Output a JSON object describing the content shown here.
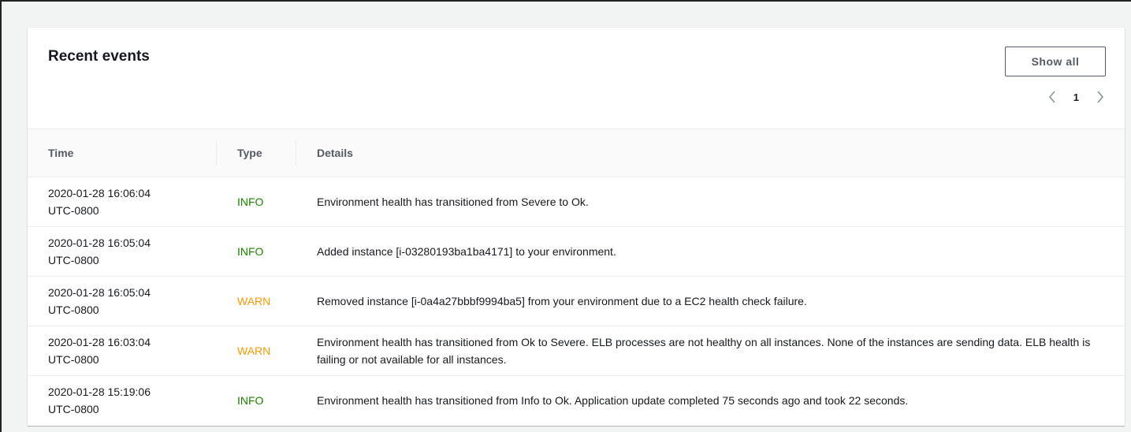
{
  "panel": {
    "title": "Recent events",
    "show_all_label": "Show all",
    "pagination": {
      "current_page": "1",
      "prev_icon": "chevron-left-icon",
      "next_icon": "chevron-right-icon"
    }
  },
  "table": {
    "columns": [
      "Time",
      "Type",
      "Details"
    ],
    "rows": [
      {
        "date": "2020-01-28 16:06:04",
        "tz": "UTC-0800",
        "type": "INFO",
        "details": "Environment health has transitioned from Severe to Ok."
      },
      {
        "date": "2020-01-28 16:05:04",
        "tz": "UTC-0800",
        "type": "INFO",
        "details": "Added instance [i-03280193ba1ba4171] to your environment."
      },
      {
        "date": "2020-01-28 16:05:04",
        "tz": "UTC-0800",
        "type": "WARN",
        "details": "Removed instance [i-0a4a27bbbf9994ba5] from your environment due to a EC2 health check failure."
      },
      {
        "date": "2020-01-28 16:03:04",
        "tz": "UTC-0800",
        "type": "WARN",
        "details": "Environment health has transitioned from Ok to Severe. ELB processes are not healthy on all instances. None of the instances are sending data. ELB health is failing or not available for all instances."
      },
      {
        "date": "2020-01-28 15:19:06",
        "tz": "UTC-0800",
        "type": "INFO",
        "details": "Environment health has transitioned from Info to Ok. Application update completed 75 seconds ago and took 22 seconds."
      }
    ]
  },
  "colors": {
    "info": "#1d8102",
    "warn": "#ff9900"
  }
}
